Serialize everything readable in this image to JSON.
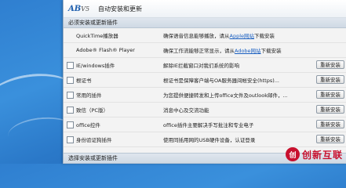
{
  "window": {
    "logo": "AB",
    "logo_version": "V5",
    "title": "自动安装和更新"
  },
  "sections": {
    "required": "必须安装或更新插件",
    "optional": "选择安装或更新插件"
  },
  "rows": [
    {
      "name": "QuickTime播放器",
      "desc_pre": "确保语音信息能够播放，请从",
      "link": "Apple网站",
      "desc_post": "下载安装",
      "button": "",
      "checkbox": false
    },
    {
      "name": "Adobe® Flash® Player",
      "desc_pre": "确保工作流能够正常显示，请从",
      "link": "Adobe网站",
      "desc_post": "下载安装",
      "button": "",
      "checkbox": false
    },
    {
      "name": "IE/windows插件",
      "desc_pre": "解除IE拦截窗口对我们系统的影响",
      "link": "",
      "desc_post": "",
      "button": "重新安装",
      "checkbox": true
    },
    {
      "name": "根证书",
      "desc_pre": "根证书是保障客户端与OA服务器间帐安全(https)...",
      "link": "",
      "desc_post": "",
      "button": "重新安装",
      "checkbox": true
    },
    {
      "name": "常用的插件",
      "desc_pre": "为您提供便捷转发和上传office文件及outlook邮件，...",
      "link": "",
      "desc_post": "",
      "button": "重新安装",
      "checkbox": true
    },
    {
      "name": "致信（PC版）",
      "desc_pre": "消息中心及交流功能",
      "link": "",
      "desc_post": "",
      "button": "重新安装",
      "checkbox": true
    },
    {
      "name": "office控件",
      "desc_pre": "office插件主要解决手写批注和专业电子",
      "link": "",
      "desc_post": "",
      "button": "重新安装",
      "checkbox": true
    },
    {
      "name": "身份验证狗插件",
      "desc_pre": "使用同插用网的USB硬件设备，认证登录",
      "link": "",
      "desc_post": "",
      "button": "重新安装",
      "checkbox": true
    }
  ],
  "watermark": {
    "symbol": "创",
    "text": "创新互联"
  }
}
